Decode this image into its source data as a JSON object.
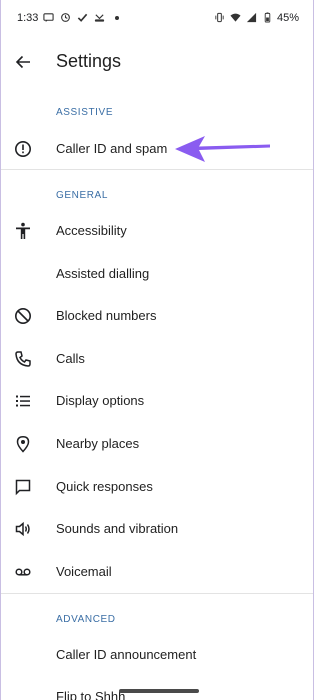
{
  "status_bar": {
    "time": "1:33",
    "battery": "45%"
  },
  "header": {
    "title": "Settings"
  },
  "sections": {
    "assistive": {
      "label": "ASSISTIVE",
      "items": [
        {
          "label": "Caller ID and spam",
          "icon": "info-circle-icon"
        }
      ]
    },
    "general": {
      "label": "GENERAL",
      "items": [
        {
          "label": "Accessibility",
          "icon": "accessibility-icon"
        },
        {
          "label": "Assisted dialling",
          "icon": ""
        },
        {
          "label": "Blocked numbers",
          "icon": "block-icon"
        },
        {
          "label": "Calls",
          "icon": "phone-icon"
        },
        {
          "label": "Display options",
          "icon": "list-icon"
        },
        {
          "label": "Nearby places",
          "icon": "location-pin-icon"
        },
        {
          "label": "Quick responses",
          "icon": "chat-bubble-icon"
        },
        {
          "label": "Sounds and vibration",
          "icon": "speaker-icon"
        },
        {
          "label": "Voicemail",
          "icon": "voicemail-icon"
        }
      ]
    },
    "advanced": {
      "label": "ADVANCED",
      "items": [
        {
          "label": "Caller ID announcement",
          "icon": ""
        },
        {
          "label": "Flip to Shhh",
          "icon": ""
        }
      ]
    }
  },
  "colors": {
    "section_header": "#3a6ea5",
    "annotation_arrow": "#8a5cf0"
  }
}
